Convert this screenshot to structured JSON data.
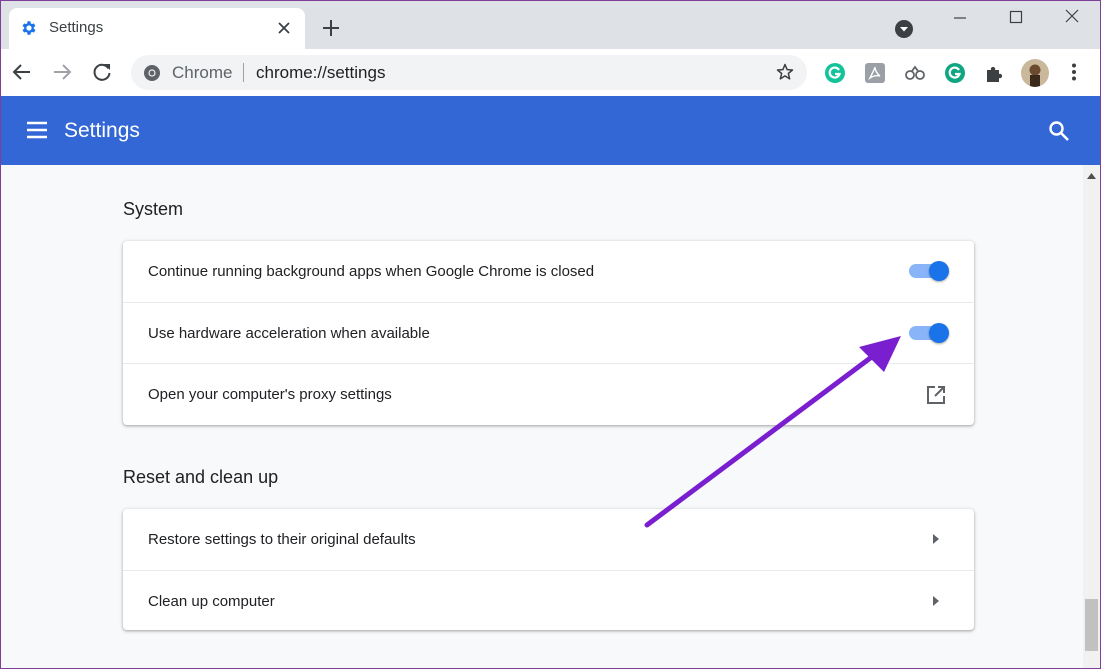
{
  "tab": {
    "title": "Settings"
  },
  "omnibox": {
    "origin": "Chrome",
    "url": "chrome://settings"
  },
  "header": {
    "title": "Settings"
  },
  "sections": {
    "system": {
      "title": "System",
      "rows": [
        {
          "label": "Continue running background apps when Google Chrome is closed",
          "control": "toggle",
          "enabled": true
        },
        {
          "label": "Use hardware acceleration when available",
          "control": "toggle",
          "enabled": true
        },
        {
          "label": "Open your computer's proxy settings",
          "control": "launch-icon"
        }
      ]
    },
    "reset": {
      "title": "Reset and clean up",
      "rows": [
        {
          "label": "Restore settings to their original defaults",
          "control": "chevron-right-icon"
        },
        {
          "label": "Clean up computer",
          "control": "chevron-right-icon"
        }
      ]
    }
  },
  "icons": {
    "tab_favicon": "gear-icon",
    "extensions": [
      "grammarly-icon",
      "acrobat-icon",
      "link-icon",
      "grammarly-alt-icon",
      "puzzle-icon"
    ]
  },
  "colors": {
    "header_bg": "#3367d6",
    "toggle_on": "#1a73e8",
    "toggle_track": "#8ab4f8",
    "annotation_arrow": "#7a1fd0"
  }
}
